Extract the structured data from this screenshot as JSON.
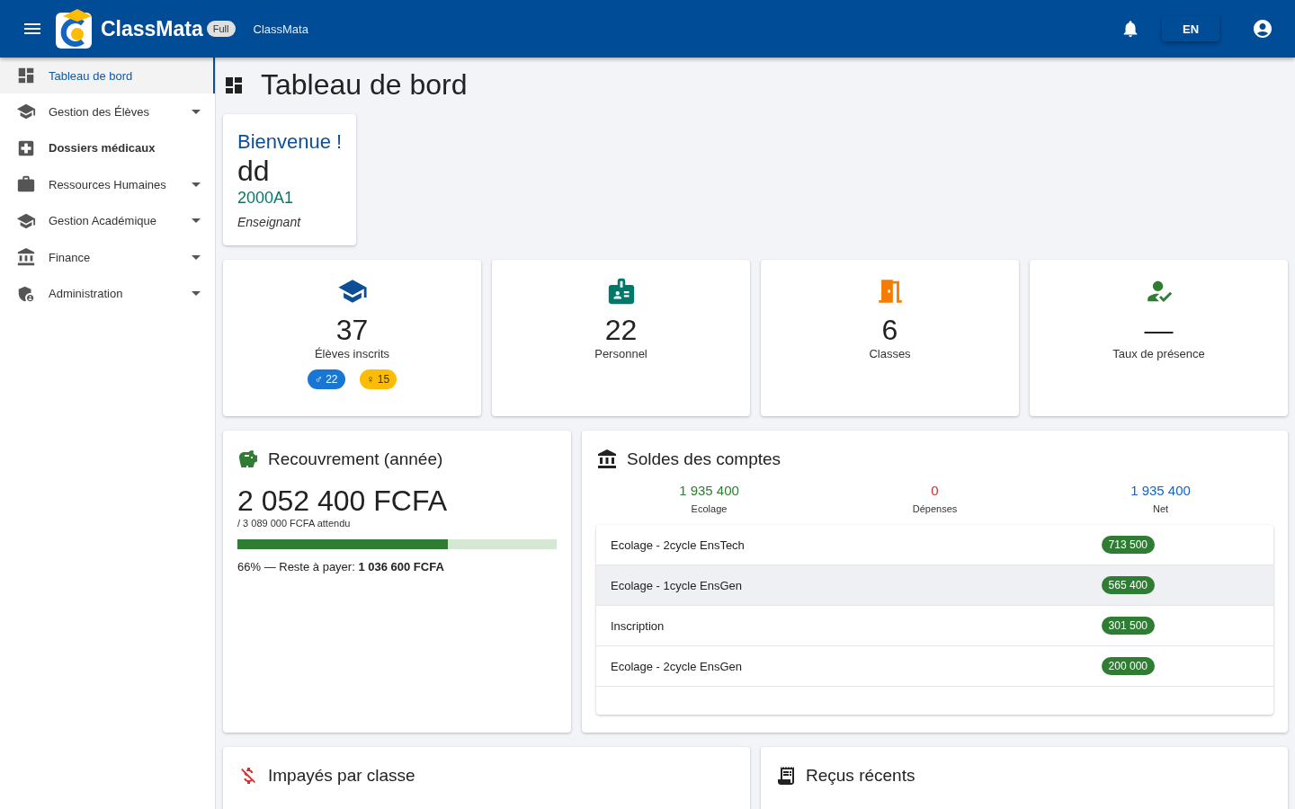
{
  "header": {
    "brand": "ClassMata",
    "plan_badge": "Full",
    "subtitle": "ClassMata",
    "language": "EN"
  },
  "sidebar": {
    "items": [
      {
        "label": "Tableau de bord",
        "kind": "link",
        "selected": true
      },
      {
        "label": "Gestion des Élèves",
        "kind": "group",
        "selected": false
      },
      {
        "label": "Dossiers médicaux",
        "kind": "link",
        "selected": false
      },
      {
        "label": "Ressources Humaines",
        "kind": "group",
        "selected": false
      },
      {
        "label": "Gestion Académique",
        "kind": "group",
        "selected": false
      },
      {
        "label": "Finance",
        "kind": "group",
        "selected": false
      },
      {
        "label": "Administration",
        "kind": "group",
        "selected": false
      }
    ]
  },
  "page_title": "Tableau de bord",
  "welcome": {
    "greeting": "Bienvenue !",
    "name": "dd",
    "code": "2000A1",
    "role": "Enseignant"
  },
  "stats": [
    {
      "value": "37",
      "label": "Élèves inscrits",
      "badges": [
        {
          "text": "♂ 22",
          "color": "#1976d2"
        },
        {
          "text": "♀ 15",
          "color": "#fbbc05"
        }
      ]
    },
    {
      "value": "22",
      "label": "Personnel"
    },
    {
      "value": "6",
      "label": "Classes"
    },
    {
      "value": "—",
      "label": "Taux de présence"
    }
  ],
  "recovery": {
    "title": "Recouvrement (année)",
    "amount": "2 052 400 FCFA",
    "expected": "/ 3 089 000 FCFA attendu",
    "level": 0.66,
    "note": "66% — Reste à payer: **1 036 600 FCFA**"
  },
  "accounts": {
    "title": "Soldes des comptes",
    "summary": [
      {
        "value": "1 935 400",
        "label": "Ecolage",
        "color": "#2e7d32"
      },
      {
        "value": "0",
        "label": "Dépenses",
        "color": "#d32f2f"
      },
      {
        "value": "1 935 400",
        "label": "Net",
        "color": "#1565c0"
      }
    ],
    "rows": [
      {
        "name": "Ecolage - 2cycle EnsTech",
        "amount": "713 500",
        "highlighted": false
      },
      {
        "name": "Ecolage - 1cycle EnsGen",
        "amount": "565 400",
        "highlighted": true
      },
      {
        "name": "Inscription",
        "amount": "301 500",
        "highlighted": false
      },
      {
        "name": "Ecolage - 2cycle EnsGen",
        "amount": "200 000",
        "highlighted": false
      }
    ]
  },
  "bottom_cards": [
    {
      "title": "Impayés par classe"
    },
    {
      "title": "Reçus récents"
    }
  ]
}
